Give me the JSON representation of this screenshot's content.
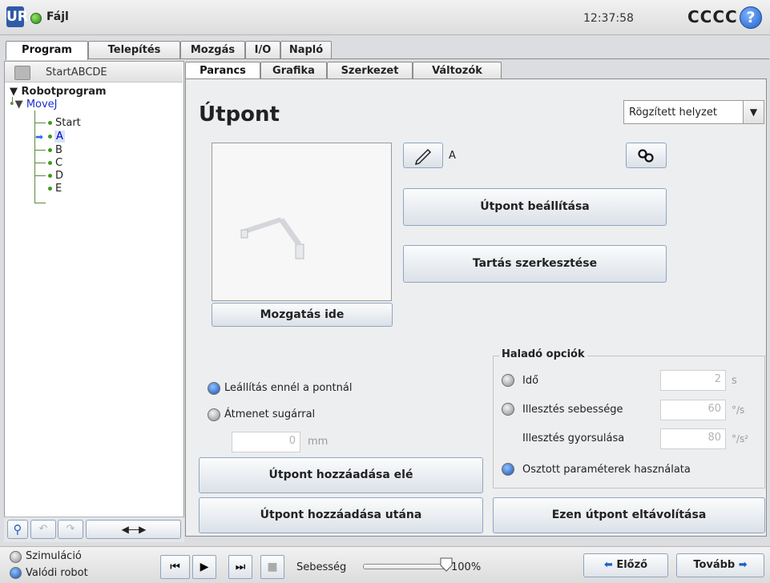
{
  "header": {
    "file_menu": "Fájl",
    "clock": "12:37:58",
    "robot_name": "CCCC",
    "help": "?",
    "logo": "UR"
  },
  "top_tabs": [
    "Program",
    "Telepítés",
    "Mozgás",
    "I/O",
    "Napló"
  ],
  "program": {
    "name": "StartABCDE",
    "tree": [
      {
        "label": "Robotprogram"
      },
      {
        "label": "MoveJ"
      },
      {
        "label": "Start"
      },
      {
        "label": "A"
      },
      {
        "label": "B"
      },
      {
        "label": "C"
      },
      {
        "label": "D"
      },
      {
        "label": "E"
      }
    ]
  },
  "sub_tabs": [
    "Parancs",
    "Grafika",
    "Szerkezet",
    "Változók"
  ],
  "main": {
    "title": "Útpont",
    "position_mode": "Rögzített helyzet",
    "waypoint_name": "A",
    "set_waypoint": "Útpont beállítása",
    "edit_pose": "Tartás szerkesztése",
    "move_here": "Mozgatás ide",
    "stop_at_point": "Leállítás ennél a pontnál",
    "blend_with_radius": "Átmenet sugárral",
    "blend_radius_value": "0",
    "blend_radius_unit": "mm",
    "add_before": "Útpont hozzáadása elé",
    "add_after": "Útpont hozzáadása utána",
    "remove_waypoint": "Ezen útpont eltávolítása"
  },
  "advanced": {
    "title": "Haladó opciók",
    "time_label": "Idő",
    "time_value": "2",
    "time_unit": "s",
    "joint_speed_label": "Illesztés sebessége",
    "joint_speed_value": "60",
    "joint_speed_unit": "°/s",
    "joint_accel_label": "Illesztés gyorsulása",
    "joint_accel_value": "80",
    "joint_accel_unit": "°/s²",
    "shared_params_label": "Osztott paraméterek használata"
  },
  "footer": {
    "simulation": "Szimuláció",
    "real_robot": "Valódi robot",
    "speed_label": "Sebesség",
    "speed_value": "100%",
    "speed_fraction": 1.0,
    "prev": "Előző",
    "next": "Tovább"
  },
  "colors": {
    "accent": "#1c4fb0",
    "tree_selected": "#0000cc",
    "run_indicator": "#3f9a1b"
  }
}
